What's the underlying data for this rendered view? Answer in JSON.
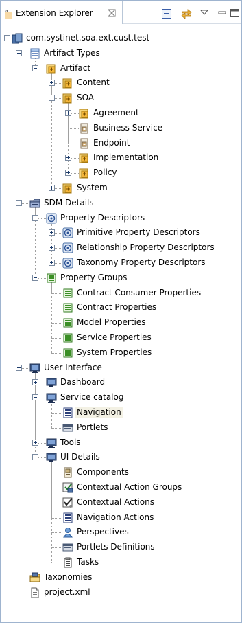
{
  "view": {
    "tab_title": "Extension Explorer",
    "toolbar": {
      "collapse_all": "collapse-all-icon",
      "link_with_editor": "link-with-editor-icon",
      "view_menu": "view-menu-icon",
      "minimize": "minimize-icon",
      "maximize": "maximize-icon"
    }
  },
  "tree": {
    "selected": "Navigation",
    "rows": [
      {
        "label": "com.systinet.soa.ext.cust.test",
        "depth": 0,
        "twisty": "minus",
        "icon": "project"
      },
      {
        "label": "Artifact Types",
        "depth": 1,
        "twisty": "minus",
        "icon": "folder-doc"
      },
      {
        "label": "Artifact",
        "depth": 2,
        "twisty": "minus",
        "icon": "artifact"
      },
      {
        "label": "Content",
        "depth": 3,
        "twisty": "plus",
        "icon": "artifact"
      },
      {
        "label": "SOA",
        "depth": 3,
        "twisty": "minus",
        "icon": "artifact"
      },
      {
        "label": "Agreement",
        "depth": 4,
        "twisty": "plus",
        "icon": "artifact"
      },
      {
        "label": "Business Service",
        "depth": 4,
        "twisty": "none",
        "icon": "artifact-leaf"
      },
      {
        "label": "Endpoint",
        "depth": 4,
        "twisty": "none",
        "icon": "artifact-leaf"
      },
      {
        "label": "Implementation",
        "depth": 4,
        "twisty": "plus",
        "icon": "artifact"
      },
      {
        "label": "Policy",
        "depth": 4,
        "twisty": "plus",
        "icon": "artifact"
      },
      {
        "label": "System",
        "depth": 3,
        "twisty": "plus",
        "icon": "artifact"
      },
      {
        "label": "SDM Details",
        "depth": 1,
        "twisty": "minus",
        "icon": "folder"
      },
      {
        "label": "Property Descriptors",
        "depth": 2,
        "twisty": "minus",
        "icon": "descriptor"
      },
      {
        "label": "Primitive Property Descriptors",
        "depth": 3,
        "twisty": "plus",
        "icon": "descriptor"
      },
      {
        "label": "Relationship Property Descriptors",
        "depth": 3,
        "twisty": "plus",
        "icon": "descriptor"
      },
      {
        "label": "Taxonomy Property Descriptors",
        "depth": 3,
        "twisty": "plus",
        "icon": "descriptor"
      },
      {
        "label": "Property Groups",
        "depth": 2,
        "twisty": "minus",
        "icon": "group"
      },
      {
        "label": "Contract Consumer Properties",
        "depth": 3,
        "twisty": "none",
        "icon": "group"
      },
      {
        "label": "Contract Properties",
        "depth": 3,
        "twisty": "none",
        "icon": "group"
      },
      {
        "label": "Model Properties",
        "depth": 3,
        "twisty": "none",
        "icon": "group"
      },
      {
        "label": "Service Properties",
        "depth": 3,
        "twisty": "none",
        "icon": "group"
      },
      {
        "label": "System Properties",
        "depth": 3,
        "twisty": "none",
        "icon": "group"
      },
      {
        "label": "User Interface",
        "depth": 1,
        "twisty": "minus",
        "icon": "monitor"
      },
      {
        "label": "Dashboard",
        "depth": 2,
        "twisty": "plus",
        "icon": "monitor"
      },
      {
        "label": "Service catalog",
        "depth": 2,
        "twisty": "minus",
        "icon": "monitor"
      },
      {
        "label": "Navigation",
        "depth": 3,
        "twisty": "none",
        "icon": "navigation"
      },
      {
        "label": "Portlets",
        "depth": 3,
        "twisty": "none",
        "icon": "portlet"
      },
      {
        "label": "Tools",
        "depth": 2,
        "twisty": "plus",
        "icon": "monitor"
      },
      {
        "label": "UI Details",
        "depth": 2,
        "twisty": "minus",
        "icon": "monitor"
      },
      {
        "label": "Components",
        "depth": 3,
        "twisty": "none",
        "icon": "component"
      },
      {
        "label": "Contextual Action Groups",
        "depth": 3,
        "twisty": "none",
        "icon": "action-group"
      },
      {
        "label": "Contextual Actions",
        "depth": 3,
        "twisty": "none",
        "icon": "action"
      },
      {
        "label": "Navigation Actions",
        "depth": 3,
        "twisty": "none",
        "icon": "navigation"
      },
      {
        "label": "Perspectives",
        "depth": 3,
        "twisty": "none",
        "icon": "perspective"
      },
      {
        "label": "Portlets Definitions",
        "depth": 3,
        "twisty": "none",
        "icon": "portlet"
      },
      {
        "label": "Tasks",
        "depth": 3,
        "twisty": "none",
        "icon": "task"
      },
      {
        "label": "Taxonomies",
        "depth": 1,
        "twisty": "none",
        "icon": "taxonomy"
      },
      {
        "label": "project.xml",
        "depth": 1,
        "twisty": "none",
        "icon": "file"
      }
    ]
  }
}
